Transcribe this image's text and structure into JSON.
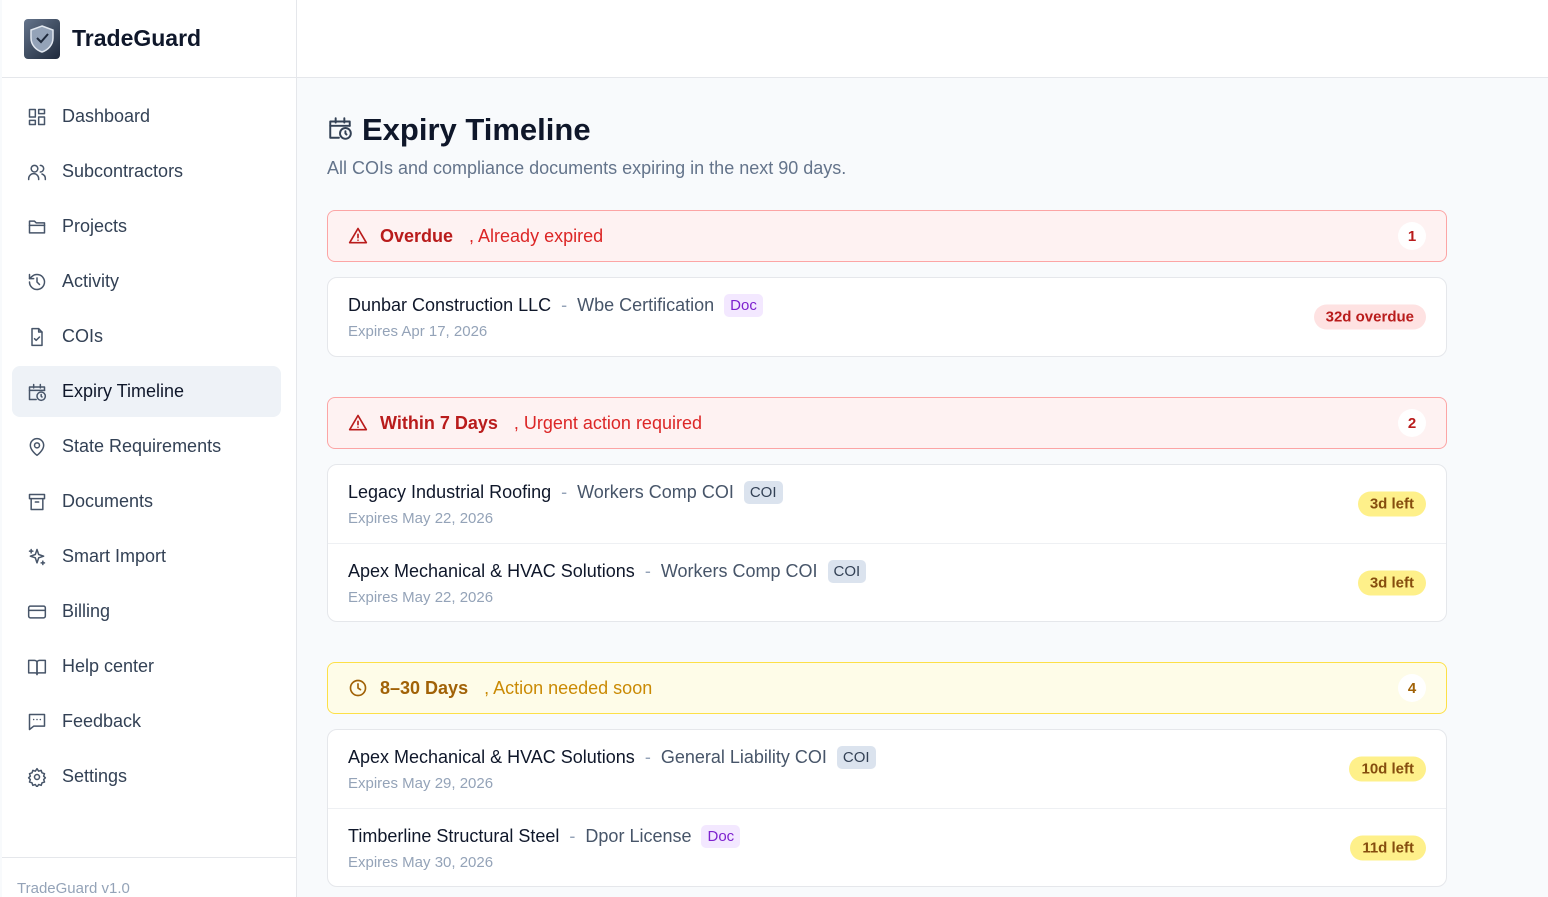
{
  "app": {
    "name": "TradeGuard",
    "version": "TradeGuard v1.0"
  },
  "sidebar": {
    "items": [
      {
        "label": "Dashboard",
        "icon": "dashboard-icon"
      },
      {
        "label": "Subcontractors",
        "icon": "users-icon"
      },
      {
        "label": "Projects",
        "icon": "folder-icon"
      },
      {
        "label": "Activity",
        "icon": "history-icon"
      },
      {
        "label": "COIs",
        "icon": "file-check-icon"
      },
      {
        "label": "Expiry Timeline",
        "icon": "calendar-clock-icon",
        "active": true
      },
      {
        "label": "State Requirements",
        "icon": "map-pin-icon"
      },
      {
        "label": "Documents",
        "icon": "archive-icon"
      },
      {
        "label": "Smart Import",
        "icon": "sparkles-icon"
      },
      {
        "label": "Billing",
        "icon": "credit-card-icon"
      },
      {
        "label": "Help center",
        "icon": "book-icon"
      },
      {
        "label": "Feedback",
        "icon": "message-icon"
      },
      {
        "label": "Settings",
        "icon": "gear-icon"
      }
    ]
  },
  "page": {
    "title": "Expiry Timeline",
    "subtitle": "All COIs and compliance documents expiring in the next 90 days."
  },
  "groups": [
    {
      "title": "Overdue",
      "subtitle": ", Already expired",
      "count": "1",
      "tone": "red",
      "items": [
        {
          "name": "Dunbar Construction LLC",
          "sep": "-",
          "doc": "Wbe Certification",
          "tag": "Doc",
          "expires": "Expires Apr 17, 2026",
          "status": "32d overdue"
        }
      ]
    },
    {
      "title": "Within 7 Days",
      "subtitle": ", Urgent action required",
      "count": "2",
      "tone": "red",
      "items": [
        {
          "name": "Legacy Industrial Roofing",
          "sep": "-",
          "doc": "Workers Comp COI",
          "tag": "COI",
          "expires": "Expires May 22, 2026",
          "status": "3d left"
        },
        {
          "name": "Apex Mechanical & HVAC Solutions",
          "sep": "-",
          "doc": "Workers Comp COI",
          "tag": "COI",
          "expires": "Expires May 22, 2026",
          "status": "3d left"
        }
      ]
    },
    {
      "title": "8–30 Days",
      "subtitle": ", Action needed soon",
      "count": "4",
      "tone": "yellow",
      "items": [
        {
          "name": "Apex Mechanical & HVAC Solutions",
          "sep": "-",
          "doc": "General Liability COI",
          "tag": "COI",
          "expires": "Expires May 29, 2026",
          "status": "10d left"
        },
        {
          "name": "Timberline Structural Steel",
          "sep": "-",
          "doc": "Dpor License",
          "tag": "Doc",
          "expires": "Expires May 30, 2026",
          "status": "11d left"
        }
      ]
    }
  ],
  "colors": {
    "accent_red": "#b91c1c",
    "accent_yellow": "#a16207",
    "active_bg": "#eef2f7"
  }
}
